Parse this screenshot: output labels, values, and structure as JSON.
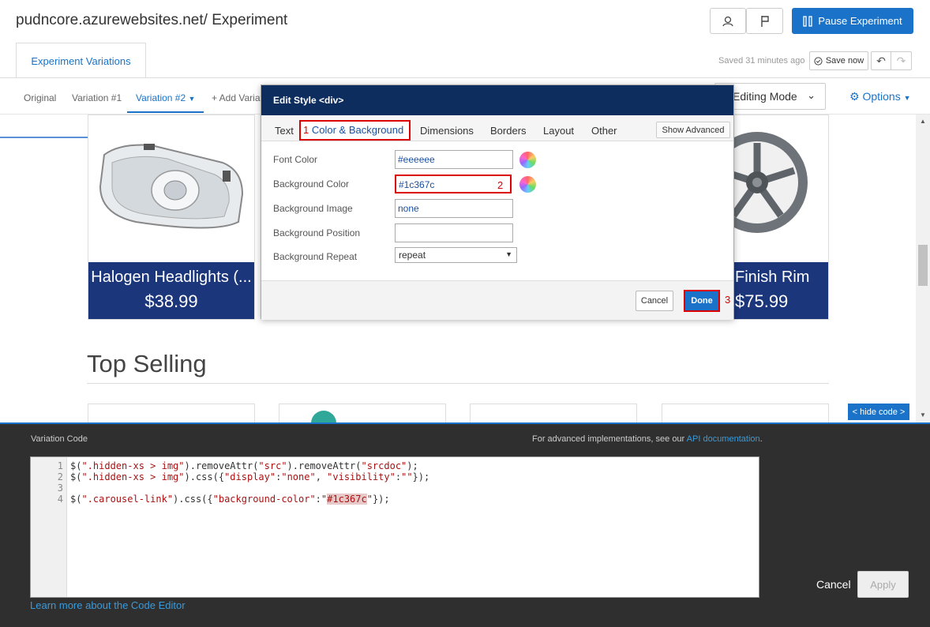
{
  "header": {
    "title": "pudncore.azurewebsites.net/ Experiment",
    "pause_label": "Pause Experiment",
    "tab_label": "Experiment Variations",
    "saved_text": "Saved 31 minutes ago",
    "save_now_label": "Save now"
  },
  "variations": {
    "tabs": [
      "Original",
      "Variation #1",
      "Variation #2",
      "+ Add Variation"
    ],
    "mode_label": "Editing Mode",
    "options_label": "Options"
  },
  "products": [
    {
      "name": "Halogen Headlights (...",
      "price": "$38.99"
    },
    {
      "name": "Finish Rim",
      "price": "$75.99"
    }
  ],
  "section_title": "Top Selling",
  "hide_code_label": "< hide code >",
  "modal": {
    "title": "Edit Style <div>",
    "tabs": [
      "Text",
      "Color & Background",
      "Dimensions",
      "Borders",
      "Layout",
      "Other"
    ],
    "color_tab_num": "1",
    "show_advanced": "Show Advanced",
    "fields": [
      {
        "label": "Font Color",
        "value": "#eeeeee"
      },
      {
        "label": "Background Color",
        "value": "#1c367c"
      },
      {
        "label": "Background Image",
        "value": "none"
      },
      {
        "label": "Background Position",
        "value": ""
      },
      {
        "label": "Background Repeat",
        "value": "repeat"
      }
    ],
    "bg_color_num": "2",
    "cancel_label": "Cancel",
    "done_label": "Done",
    "done_num": "3"
  },
  "code_panel": {
    "label": "Variation Code",
    "note_prefix": "For advanced implementations, see our ",
    "note_link": "API documentation",
    "note_suffix": ".",
    "line_numbers": [
      "1",
      "2",
      "3",
      "4"
    ],
    "learn_link": "Learn more about the Code Editor",
    "cancel_label": "Cancel",
    "apply_label": "Apply"
  },
  "colors": {
    "accent": "#1a73c8",
    "product_band": "#1c367c",
    "modal_header": "#0c2d5e",
    "highlight_red": "#dd0000"
  }
}
